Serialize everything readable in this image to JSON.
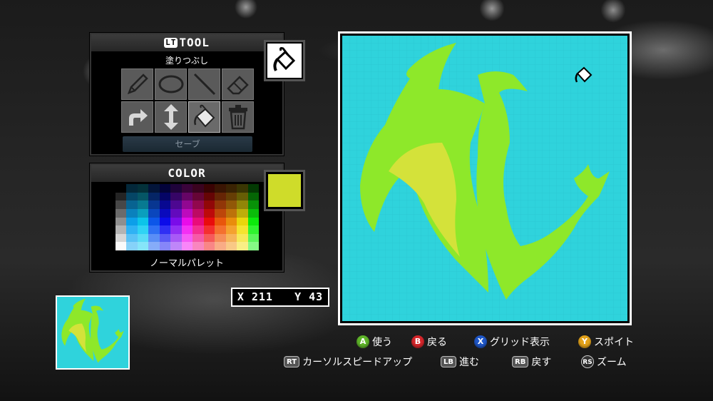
{
  "tool_panel": {
    "badge": "LT",
    "title": "TOOL",
    "current_tool": "塗りつぶし",
    "tools": [
      "pencil",
      "ellipse",
      "line",
      "eraser",
      "redo",
      "flip-vertical",
      "fill-bucket",
      "trash"
    ],
    "active_tool": "fill-bucket",
    "save_label": "セーブ"
  },
  "color_panel": {
    "title": "COLOR",
    "palette_name": "ノーマルパレット",
    "current_color": "#cfdc2a"
  },
  "coords": {
    "x_label": "X",
    "x_value": "211",
    "y_label": "Y",
    "y_value": "43"
  },
  "colors": {
    "canvas_bg": "#2fd3dc",
    "emblem_green": "#8ee82a",
    "emblem_yellow": "#d4e23a"
  },
  "hints": {
    "use": {
      "button": "A",
      "label": "使う",
      "color": "#5fb52a"
    },
    "back": {
      "button": "B",
      "label": "戻る",
      "color": "#d6262b"
    },
    "grid": {
      "button": "X",
      "label": "グリッド表示",
      "color": "#1f57c8"
    },
    "dropper": {
      "button": "Y",
      "label": "スポイト",
      "color": "#e3a21a"
    },
    "cursor_speed": {
      "button": "RT",
      "label": "カーソルスピードアップ"
    },
    "forward": {
      "button": "LB",
      "label": "進む"
    },
    "undo": {
      "button": "RB",
      "label": "戻す"
    },
    "zoom": {
      "button": "RS",
      "label": "ズーム"
    }
  }
}
